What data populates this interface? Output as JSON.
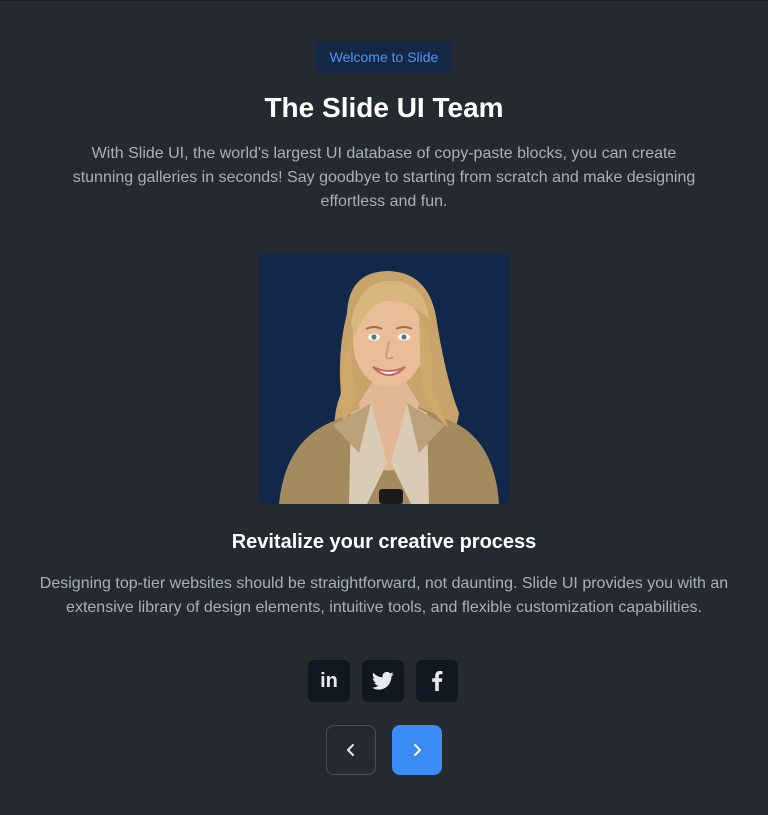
{
  "badge": {
    "label": "Welcome to Slide"
  },
  "header": {
    "title": "The Slide UI Team",
    "intro": "With Slide UI, the world's largest UI database of copy-paste blocks, you can create stunning galleries in seconds! Say goodbye to starting from scratch and make designing effortless and fun."
  },
  "slide": {
    "subtitle": "Revitalize your creative process",
    "description": "Designing top-tier websites should be straightforward, not daunting. Slide UI provides you with an extensive library of design elements, intuitive tools, and flexible customization capabilities."
  },
  "socials": [
    {
      "icon": "linkedin-icon",
      "glyph": "in"
    },
    {
      "icon": "twitter-icon"
    },
    {
      "icon": "facebook-icon"
    }
  ],
  "navigation": {
    "prev_icon": "chevron-left-icon",
    "next_icon": "chevron-right-icon"
  },
  "colors": {
    "background": "#252a31",
    "accent": "#3b8cf5",
    "badge_bg": "#142846",
    "photo_bg": "#11284a"
  }
}
